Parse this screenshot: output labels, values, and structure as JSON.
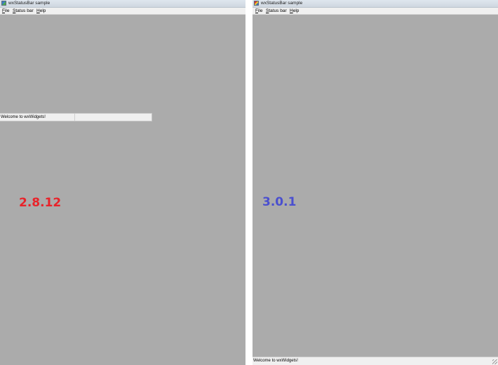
{
  "windows": [
    {
      "title": "wxStatusBar sample",
      "menu": [
        {
          "mnemonic": "F",
          "rest": "ile"
        },
        {
          "mnemonic": "S",
          "rest": "tatus bar"
        },
        {
          "mnemonic": "H",
          "rest": "elp"
        }
      ],
      "status_text": "Welcome to wxWidgets!",
      "status_field2": "",
      "version_label": "2.8.12",
      "version_color": "#e8232a"
    },
    {
      "title": "wxStatusBar sample",
      "menu": [
        {
          "mnemonic": "F",
          "rest": "ile"
        },
        {
          "mnemonic": "S",
          "rest": "tatus bar"
        },
        {
          "mnemonic": "H",
          "rest": "elp"
        }
      ],
      "status_text": "Welcome to wxWidgets!",
      "version_label": "3.0.1",
      "version_color": "#4a4fcf"
    }
  ],
  "colors": {
    "client_area": "#ababab",
    "menubar": "#f0f0f0",
    "statusbar": "#f0f0f0"
  }
}
